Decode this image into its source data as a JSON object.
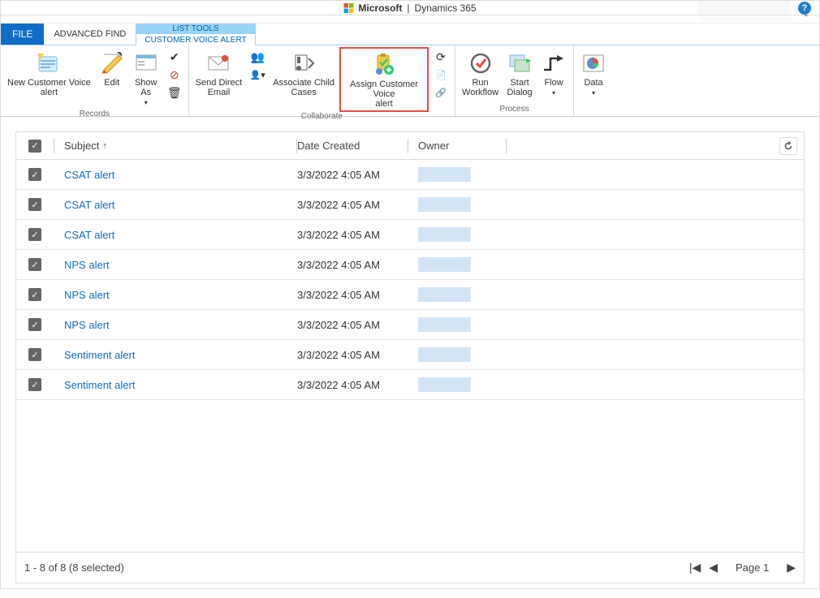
{
  "header": {
    "brand_prefix": "Microsoft",
    "brand_app": "Dynamics 365"
  },
  "tabs": {
    "file": "FILE",
    "advanced_find": "ADVANCED FIND",
    "group_header": "LIST TOOLS",
    "active_tab": "CUSTOMER VOICE ALERT"
  },
  "ribbon": {
    "records": {
      "label": "Records",
      "new_alert": "New Customer Voice\nalert",
      "edit": "Edit",
      "show_as": "Show\nAs"
    },
    "collaborate": {
      "label": "Collaborate",
      "send_email": "Send Direct\nEmail",
      "associate": "Associate Child\nCases",
      "assign": "Assign Customer Voice\nalert"
    },
    "process": {
      "label": "Process",
      "run_wf": "Run\nWorkflow",
      "start_dialog": "Start\nDialog",
      "flow": "Flow",
      "data": "Data"
    }
  },
  "grid": {
    "columns": {
      "subject": "Subject",
      "date": "Date Created",
      "owner": "Owner"
    },
    "rows": [
      {
        "subject": "CSAT alert",
        "date": "3/3/2022 4:05 AM"
      },
      {
        "subject": "CSAT alert",
        "date": "3/3/2022 4:05 AM"
      },
      {
        "subject": "CSAT alert",
        "date": "3/3/2022 4:05 AM"
      },
      {
        "subject": "NPS alert",
        "date": "3/3/2022 4:05 AM"
      },
      {
        "subject": "NPS alert",
        "date": "3/3/2022 4:05 AM"
      },
      {
        "subject": "NPS alert",
        "date": "3/3/2022 4:05 AM"
      },
      {
        "subject": "Sentiment alert",
        "date": "3/3/2022 4:05 AM"
      },
      {
        "subject": "Sentiment alert",
        "date": "3/3/2022 4:05 AM"
      }
    ],
    "footer": {
      "status": "1 - 8 of 8 (8 selected)",
      "page_label": "Page 1"
    }
  }
}
